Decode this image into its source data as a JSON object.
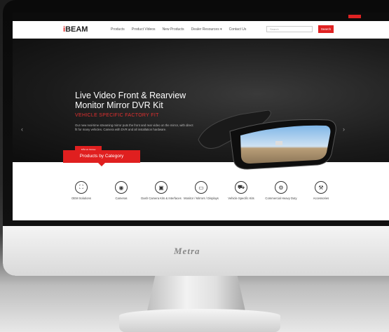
{
  "header": {
    "utility_text": "",
    "logo_text_red": "i",
    "logo_text": "BEAM",
    "nav": [
      "Products",
      "Product Videos",
      "New Products",
      "Dealer Resources ▾",
      "Contact Us"
    ],
    "search_placeholder": "Search",
    "search_button": "Search"
  },
  "hero": {
    "title": "Live Video Front & Rearview Monitor Mirror DVR Kit",
    "subtitle": "VEHICLE SPECIFIC FACTORY FIT",
    "description": "Our new real-time streaming mirror puts the front and rear video on the mirror, with direct fit for many vehicles. Camera with DVR and all installation hardware.",
    "cta": "Shop Now",
    "slides": 3,
    "active_slide": 3
  },
  "categories": {
    "tab_label": "Products by Category",
    "items": [
      {
        "label": "OEM Solutions",
        "icon": "car-seat-icon"
      },
      {
        "label": "Cameras",
        "icon": "camera-icon"
      },
      {
        "label": "Dash Camera Kits & Interfaces",
        "icon": "dash-camera-icon"
      },
      {
        "label": "Monitor / Mirrors / Displays",
        "icon": "monitor-icon"
      },
      {
        "label": "Vehicle Specific Kits",
        "icon": "vehicle-icon"
      },
      {
        "label": "Commercial Heavy Duty",
        "icon": "truck-icon"
      },
      {
        "label": "Accessories",
        "icon": "tools-icon"
      }
    ]
  },
  "monitor_brand": "Metra"
}
